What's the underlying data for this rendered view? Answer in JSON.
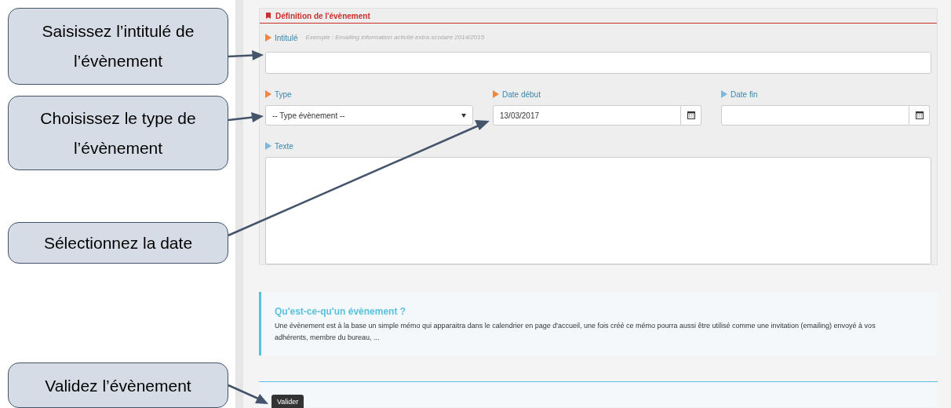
{
  "callouts": [
    {
      "text": "Saisissez l’intitulé de l’évènement"
    },
    {
      "text": "Choisissez le type de l’évènement"
    },
    {
      "text": "Sélectionnez la date"
    },
    {
      "text": "Validez l’évènement"
    }
  ],
  "panel": {
    "title": "Définition de l'évènement",
    "intitule": {
      "label": "Intitulé",
      "required": true,
      "hint": "Exemple : Emailing information activité extra-scolaire 2014/2015"
    },
    "type": {
      "label": "Type",
      "required": true,
      "value": "-- Type évènement --"
    },
    "date_debut": {
      "label": "Date début",
      "required": true,
      "value": "13/03/2017"
    },
    "date_fin": {
      "label": "Date fin",
      "required": false
    },
    "texte": {
      "label": "Texte",
      "required": false
    }
  },
  "info": {
    "title": "Qu'est-ce-qu'un évènement ?",
    "text": "Une évènement est à la base un simple mémo qui apparaitra dans le calendrier en page d'accueil, une fois créé ce mémo pourra aussi être utilisé comme une invitation (emailing) envoyé à vos adhérents, membre du bureau, ..."
  },
  "submit": "Valider"
}
